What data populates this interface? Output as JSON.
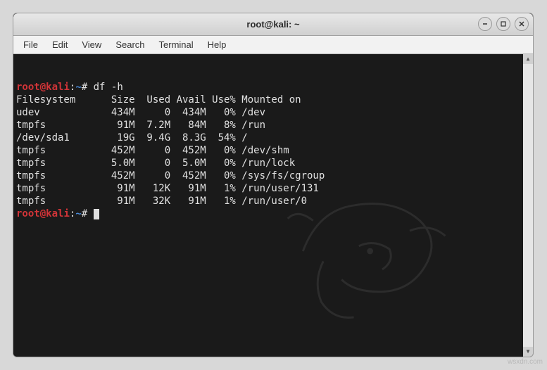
{
  "window": {
    "title": "root@kali: ~"
  },
  "menu": {
    "file": "File",
    "edit": "Edit",
    "view": "View",
    "search": "Search",
    "terminal": "Terminal",
    "help": "Help"
  },
  "prompt": {
    "user": "root",
    "at": "@",
    "host": "kali",
    "colon": ":",
    "path": "~",
    "hash": "#"
  },
  "command": "df -h",
  "df_header": "Filesystem      Size  Used Avail Use% Mounted on",
  "df_rows": [
    "udev            434M     0  434M   0% /dev",
    "tmpfs            91M  7.2M   84M   8% /run",
    "/dev/sda1        19G  9.4G  8.3G  54% /",
    "tmpfs           452M     0  452M   0% /dev/shm",
    "tmpfs           5.0M     0  5.0M   0% /run/lock",
    "tmpfs           452M     0  452M   0% /sys/fs/cgroup",
    "tmpfs            91M   12K   91M   1% /run/user/131",
    "tmpfs            91M   32K   91M   1% /run/user/0"
  ],
  "watermark": "wsxdn.com"
}
